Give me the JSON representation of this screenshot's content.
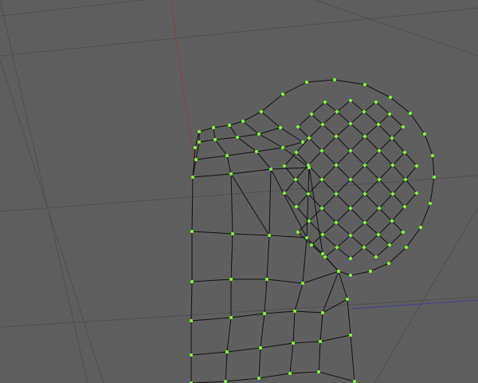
{
  "viewport": {
    "background_color": "#5f5f5f",
    "grid_color": "#505050",
    "axis_y_color": "#8f3f3f",
    "axis_x_color": "#3f3f8f"
  },
  "mesh": {
    "edge_color": "#111111",
    "vertex_color": "#7fff32",
    "selection_mode": "vertex",
    "vertices_selected": "all"
  }
}
